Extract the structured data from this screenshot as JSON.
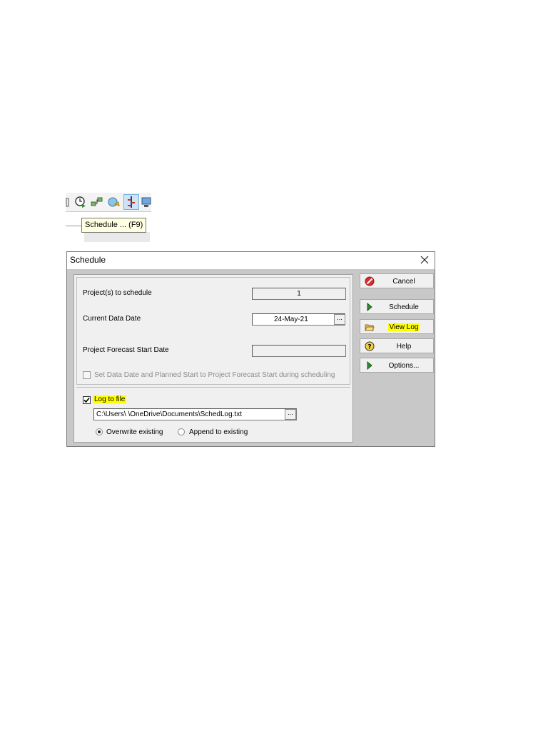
{
  "toolbar": {
    "icons": [
      "toolbar-overflow-icon",
      "schedule-clock-icon",
      "network-icon",
      "globe-refresh-icon",
      "level-resources-icon",
      "monitor-icon"
    ],
    "tooltip": "Schedule ... (F9)"
  },
  "dialog": {
    "title": "Schedule",
    "projects_label": "Project(s) to schedule",
    "projects_value": "1",
    "data_date_label": "Current Data Date",
    "data_date_value": "24-May-21",
    "browse_label": "...",
    "forecast_label": "Project Forecast Start Date",
    "forecast_value": "",
    "set_data_date_label": "Set Data Date and Planned Start to Project Forecast Start during scheduling",
    "log_to_file_label": "Log to file",
    "log_path_value": "C:\\Users\\ \\OneDrive\\Documents\\SchedLog.txt",
    "overwrite_label": "Overwrite existing",
    "append_label": "Append to existing",
    "buttons": {
      "cancel": "Cancel",
      "schedule": "Schedule",
      "view_log": "View Log",
      "help": "Help",
      "options": "Options..."
    }
  },
  "colors": {
    "highlight": "#ffff00",
    "tooltip_bg": "#ffffe1",
    "dialog_bg": "#f0f0f0",
    "cancel_red": "#d32f2f",
    "arrow_green": "#2e8b2e"
  }
}
